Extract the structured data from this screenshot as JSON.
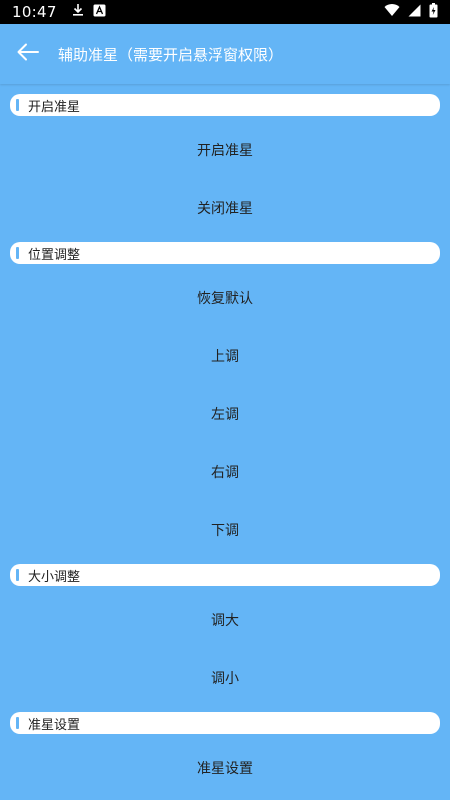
{
  "status_bar": {
    "time": "10:47"
  },
  "app_bar": {
    "title": "辅助准星（需要开启悬浮窗权限）"
  },
  "sections": [
    {
      "header": "开启准星",
      "items": [
        "开启准星",
        "关闭准星"
      ]
    },
    {
      "header": "位置调整",
      "items": [
        "恢复默认",
        "上调",
        "左调",
        "右调",
        "下调"
      ]
    },
    {
      "header": "大小调整",
      "items": [
        "调大",
        "调小"
      ]
    },
    {
      "header": "准星设置",
      "items": [
        "准星设置"
      ]
    }
  ],
  "colors": {
    "background": "#64b5f6",
    "header_bg": "#ffffff",
    "accent_bar": "#64b5f6",
    "status_bar": "#000000"
  }
}
